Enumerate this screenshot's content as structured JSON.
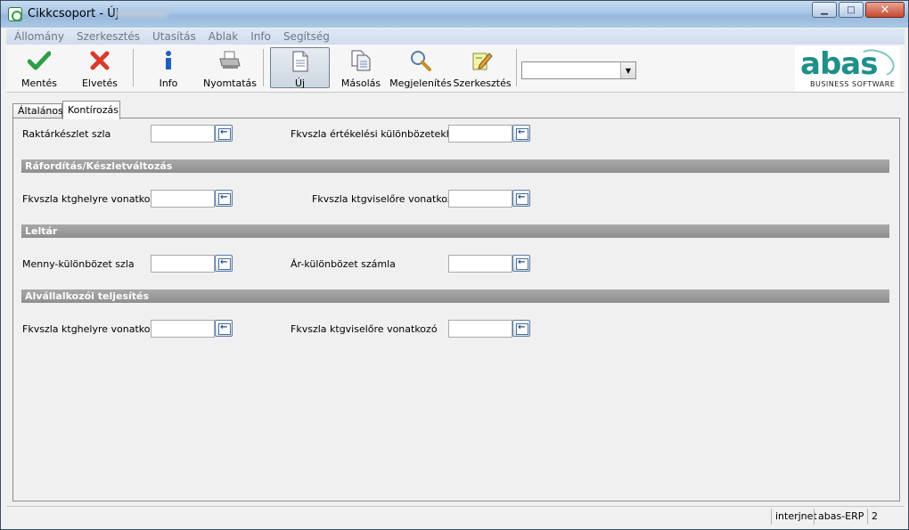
{
  "window": {
    "title": "Cikkcsoport - Új",
    "controls": {
      "minimize": "▁",
      "maximize": "□",
      "close": "✕"
    }
  },
  "menu": [
    "Állomány",
    "Szerkesztés",
    "Utasítás",
    "Ablak",
    "Info",
    "Segítség"
  ],
  "toolbar": {
    "save": "Mentés",
    "discard": "Elvetés",
    "info": "Info",
    "print": "Nyomtatás",
    "new": "Új",
    "copy": "Másolás",
    "display": "Megjelenítés",
    "edit": "Szerkesztés",
    "combo_value": ""
  },
  "logo": {
    "word": "abas",
    "tagline": "BUSINESS SOFTWARE"
  },
  "tabs": [
    "Általános",
    "Kontírozás"
  ],
  "active_tab": "Kontírozás",
  "form": {
    "row1": {
      "left_label": "Raktárkészlet szla",
      "left_value": "",
      "right_label": "Fkvszla értékelési különbözetekhez",
      "right_value": ""
    },
    "section1": "Ráfordítás/Készletváltozás",
    "row2": {
      "left_label": "Fkvszla ktghelyre vonatkozó",
      "left_value": "",
      "right_label": "Fkvszla ktgviselőre vonatkozó",
      "right_value": ""
    },
    "section2": "Leltár",
    "row3": {
      "left_label": "Menny-különbözet szla",
      "left_value": "",
      "right_label": "Ár-különbözet számla",
      "right_value": ""
    },
    "section3": "Alvállalkozói teljesítés",
    "row4": {
      "left_label": "Fkvszla ktghelyre vonatkozó",
      "left_value": "",
      "right_label": "Fkvszla ktgviselőre vonatkozó",
      "right_value": ""
    }
  },
  "status": {
    "mode": "interjnet",
    "app": "abas-ERP",
    "number": "2"
  },
  "colors": {
    "section_bar": "#999999",
    "logo_teal": "#1e8f89",
    "save_green": "#2e9e45",
    "discard_red": "#d93a2b"
  }
}
